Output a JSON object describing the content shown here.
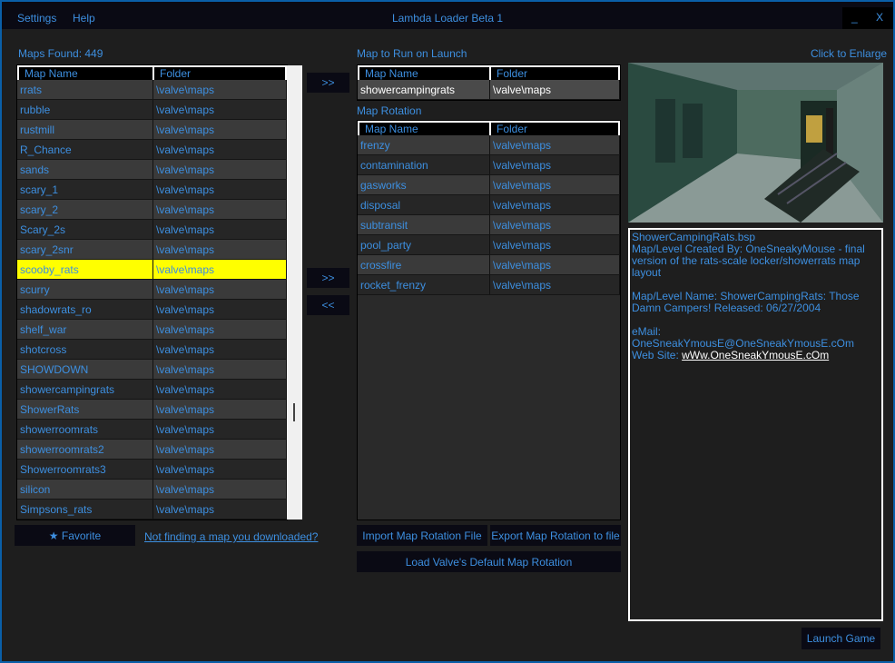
{
  "window": {
    "title": "Lambda Loader Beta 1",
    "minimize": "_",
    "close": "X"
  },
  "menu": {
    "settings": "Settings",
    "help": "Help"
  },
  "maps_found": "Maps Found: 449",
  "map_list": {
    "headers": {
      "name": "Map Name",
      "folder": "Folder"
    },
    "rows": [
      {
        "name": "rrats",
        "folder": "\\valve\\maps"
      },
      {
        "name": "rubble",
        "folder": "\\valve\\maps"
      },
      {
        "name": "rustmill",
        "folder": "\\valve\\maps"
      },
      {
        "name": "R_Chance",
        "folder": "\\valve\\maps"
      },
      {
        "name": "sands",
        "folder": "\\valve\\maps"
      },
      {
        "name": "scary_1",
        "folder": "\\valve\\maps"
      },
      {
        "name": "scary_2",
        "folder": "\\valve\\maps"
      },
      {
        "name": "Scary_2s",
        "folder": "\\valve\\maps"
      },
      {
        "name": "scary_2snr",
        "folder": "\\valve\\maps"
      },
      {
        "name": "scooby_rats",
        "folder": "\\valve\\maps"
      },
      {
        "name": "scurry",
        "folder": "\\valve\\maps"
      },
      {
        "name": "shadowrats_ro",
        "folder": "\\valve\\maps"
      },
      {
        "name": "shelf_war",
        "folder": "\\valve\\maps"
      },
      {
        "name": "shotcross",
        "folder": "\\valve\\maps"
      },
      {
        "name": "SHOWDOWN",
        "folder": "\\valve\\maps"
      },
      {
        "name": "showercampingrats",
        "folder": "\\valve\\maps"
      },
      {
        "name": "ShowerRats",
        "folder": "\\valve\\maps"
      },
      {
        "name": "showerroomrats",
        "folder": "\\valve\\maps"
      },
      {
        "name": "showerroomrats2",
        "folder": "\\valve\\maps"
      },
      {
        "name": "Showerroomrats3",
        "folder": "\\valve\\maps"
      },
      {
        "name": "silicon",
        "folder": "\\valve\\maps"
      },
      {
        "name": "Simpsons_rats",
        "folder": "\\valve\\maps"
      }
    ],
    "selected_index": 9
  },
  "launch": {
    "label": "Map to Run on Launch",
    "headers": {
      "name": "Map Name",
      "folder": "Folder"
    },
    "row": {
      "name": "showercampingrats",
      "folder": "\\valve\\maps"
    }
  },
  "rotation": {
    "label": "Map Rotation",
    "headers": {
      "name": "Map Name",
      "folder": "Folder"
    },
    "rows": [
      {
        "name": "frenzy",
        "folder": "\\valve\\maps"
      },
      {
        "name": "contamination",
        "folder": "\\valve\\maps"
      },
      {
        "name": "gasworks",
        "folder": "\\valve\\maps"
      },
      {
        "name": "disposal",
        "folder": "\\valve\\maps"
      },
      {
        "name": "subtransit",
        "folder": "\\valve\\maps"
      },
      {
        "name": "pool_party",
        "folder": "\\valve\\maps"
      },
      {
        "name": "crossfire",
        "folder": "\\valve\\maps"
      },
      {
        "name": "rocket_frenzy",
        "folder": "\\valve\\maps"
      }
    ]
  },
  "buttons": {
    "set_launch": ">>",
    "add_rotation": ">>",
    "remove_rotation": "<<",
    "favorite": "★ Favorite",
    "not_finding": "Not finding a map you downloaded?",
    "import": "Import Map Rotation File",
    "export": "Export Map Rotation to file",
    "load_default": "Load Valve's Default Map Rotation",
    "launch_game": "Launch Game"
  },
  "preview": {
    "enlarge": "Click to Enlarge"
  },
  "info": {
    "file": "ShowerCampingRats.bsp",
    "created": "Map/Level Created By: OneSneakyMouse - final version of the rats-scale locker/showerrats map layout",
    "name": "Map/Level Name: ShowerCampingRats: Those Damn Campers! Released: 06/27/2004",
    "email": "eMail: OneSneakYmousE@OneSneakYmousE.cOm",
    "website_label": "Web Site: ",
    "website": "wWw.OneSneakYmousE.cOm"
  },
  "colors": {
    "accent": "#3d8fe0",
    "selection": "#ffff00",
    "border": "#0a5fa8"
  }
}
